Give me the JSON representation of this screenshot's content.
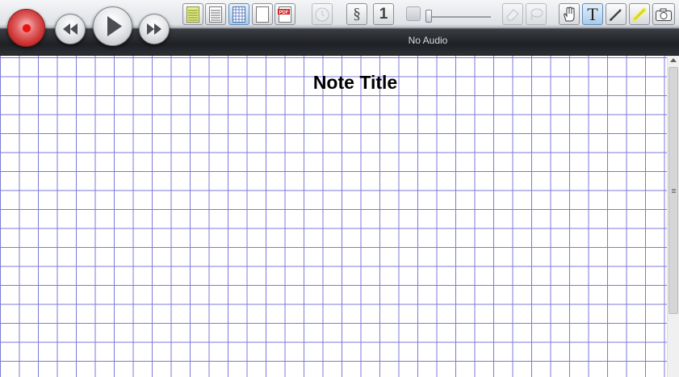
{
  "audio": {
    "status": "No Audio"
  },
  "note": {
    "title": "Note Title"
  },
  "toolbar": {
    "paper_styles": [
      "lined-yellow-paper-icon",
      "lined-white-paper-icon",
      "grid-paper-icon",
      "blank-paper-icon",
      "pdf-icon"
    ],
    "active_paper": "grid-paper-icon",
    "insert_tools": [
      "section-symbol-icon",
      "numbered-list-icon"
    ],
    "pdf_badge": "PDF",
    "section_glyph": "§",
    "number_glyph": "1",
    "text_glyph": "T",
    "active_tool": "text-tool"
  },
  "colors": {
    "grid_line": "#7d7ad8",
    "record_red": "#e41414",
    "toolbar_dark": "#1e2024",
    "highlighter_yellow": "#f2ee3a"
  }
}
